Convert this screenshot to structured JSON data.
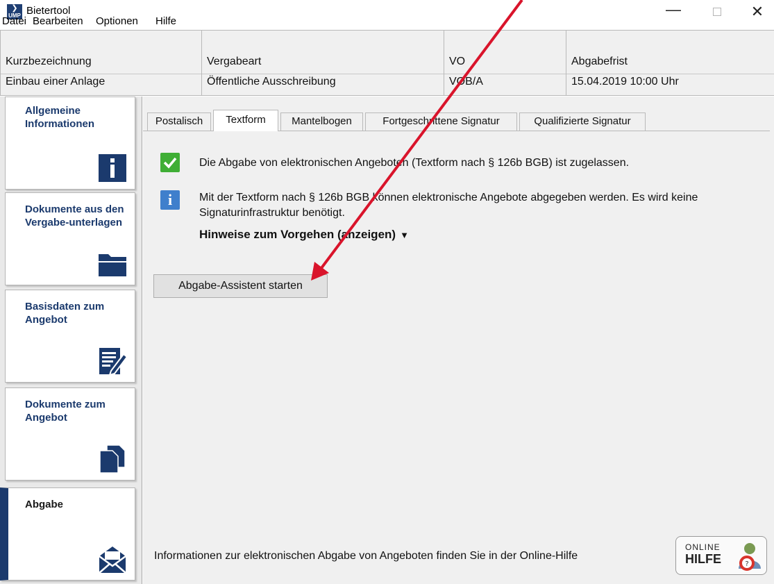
{
  "window": {
    "title": "Bietertool",
    "app_icon_text": "UMP"
  },
  "menu": {
    "items": [
      "Datei",
      "Bearbeiten",
      "Optionen",
      "Hilfe"
    ]
  },
  "info_header": {
    "columns": [
      {
        "label": "Kurzbezeichnung",
        "value": "Einbau einer Anlage"
      },
      {
        "label": "Vergabeart",
        "value": "Öffentliche Ausschreibung"
      },
      {
        "label": "VO",
        "value": "VOB/A"
      },
      {
        "label": "Abgabefrist",
        "value": "15.04.2019 10:00 Uhr"
      }
    ]
  },
  "sidebar": {
    "items": [
      {
        "label": "Allgemeine Informationen",
        "icon": "info-icon",
        "active": false
      },
      {
        "label": "Dokumente aus den Vergabe-unterlagen",
        "icon": "folder-icon",
        "active": false
      },
      {
        "label": "Basisdaten zum Angebot",
        "icon": "edit-document-icon",
        "active": false
      },
      {
        "label": "Dokumente zum Angebot",
        "icon": "documents-icon",
        "active": false
      },
      {
        "label": "Abgabe",
        "icon": "envelope-icon",
        "active": true
      }
    ]
  },
  "tabs": {
    "items": [
      "Postalisch",
      "Textform",
      "Mantelbogen",
      "Fortgeschrittene Signatur",
      "Qualifizierte Signatur"
    ],
    "active": "Textform"
  },
  "content": {
    "allowed_message": "Die Abgabe von elektronischen Angeboten (Textform nach § 126b BGB) ist zugelassen.",
    "info_message": "Mit der Textform nach § 126b BGB können elektronische Angebote abgegeben werden. Es wird keine Signaturinfrastruktur benötigt.",
    "hint_toggle": "Hinweise zum Vorgehen (anzeigen)",
    "start_button": "Abgabe-Assistent starten",
    "footer_text": "Informationen zur elektronischen Abgabe von Angeboten finden Sie in der Online-Hilfe",
    "online_help_line1": "ONLINE",
    "online_help_line2": "HILFE"
  },
  "colors": {
    "accent": "#1b3a6d",
    "annotation_arrow": "#d9142b",
    "check_green": "#3fae35",
    "info_blue": "#3f7fcc"
  }
}
